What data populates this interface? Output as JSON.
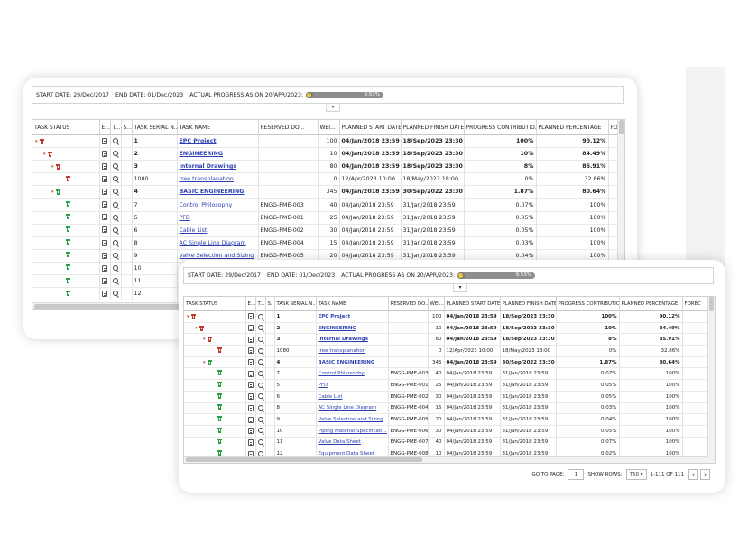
{
  "header": {
    "start_label": "START DATE:",
    "start_value": "29/Dec/2017",
    "end_label": "END DATE:",
    "end_value": "01/Dec/2023",
    "progress_label": "ACTUAL PROGRESS AS ON 20/APR/2023:",
    "progress_text": "9.53%",
    "progress_fraction": 0.0953
  },
  "columns_main": [
    "TASK STATUS",
    "E...",
    "T...",
    "S...",
    "TASK SERIAL N...",
    "TASK NAME",
    "RESERVED DO...",
    "WEI...",
    "PLANNED START DATE",
    "PLANNED FINISH DATE",
    "PROGRESS CONTRIBUTIO...",
    "PLANNED PERCENTAGE",
    "FOREC"
  ],
  "columns_front": [
    "TASK STATUS",
    "E...",
    "T...",
    "S...",
    "TASK SERIAL N...",
    "TASK NAME",
    "RESERVED DO...",
    "WEI...",
    "PLANNED START DATE",
    "PLANNED FINISH DATE",
    "PROGRESS CONTRIBUTIO...",
    "PLANNED PERCENTAGE",
    "FOREC"
  ],
  "rows_back": [
    {
      "serial": "1",
      "name": "EPC Project",
      "reserved": "",
      "weight": "100",
      "start": "04/Jan/2018 23:59",
      "finish": "18/Sep/2023 23:30",
      "contrib": "100%",
      "planned": "90.12%",
      "level": 0,
      "summary": true,
      "color": "red"
    },
    {
      "serial": "2",
      "name": "ENGINEERING",
      "reserved": "",
      "weight": "10",
      "start": "04/Jan/2018 23:59",
      "finish": "18/Sep/2023 23:30",
      "contrib": "10%",
      "planned": "84.49%",
      "level": 1,
      "summary": true,
      "color": "red"
    },
    {
      "serial": "3",
      "name": "Internal Drawings",
      "reserved": "",
      "weight": "80",
      "start": "04/Jan/2018 23:59",
      "finish": "18/Sep/2023 23:30",
      "contrib": "8%",
      "planned": "85.91%",
      "level": 2,
      "summary": true,
      "color": "red"
    },
    {
      "serial": "1080",
      "name": "tree transplanation",
      "reserved": "",
      "weight": "0",
      "start": "12/Apr/2023 10:00",
      "finish": "18/May/2023 18:00",
      "contrib": "0%",
      "planned": "32.86%",
      "level": 3,
      "summary": false,
      "color": "red"
    },
    {
      "serial": "4",
      "name": "BASIC ENGINEERING",
      "reserved": "",
      "weight": "345",
      "start": "04/Jan/2018 23:59",
      "finish": "30/Sep/2022 23:30",
      "contrib": "1.87%",
      "planned": "80.64%",
      "level": 2,
      "summary": true,
      "color": "green"
    },
    {
      "serial": "7",
      "name": "Control Philosophy",
      "reserved": "ENGG-PME-003",
      "weight": "40",
      "start": "04/Jan/2018 23:59",
      "finish": "31/Jan/2018 23:59",
      "contrib": "0.07%",
      "planned": "100%",
      "level": 3,
      "summary": false,
      "color": "green"
    },
    {
      "serial": "5",
      "name": "PFD",
      "reserved": "ENGG-PME-001",
      "weight": "25",
      "start": "04/Jan/2018 23:59",
      "finish": "31/Jan/2018 23:59",
      "contrib": "0.05%",
      "planned": "100%",
      "level": 3,
      "summary": false,
      "color": "green"
    },
    {
      "serial": "6",
      "name": "Cable List",
      "reserved": "ENGG-PME-002",
      "weight": "30",
      "start": "04/Jan/2018 23:59",
      "finish": "31/Jan/2018 23:59",
      "contrib": "0.05%",
      "planned": "100%",
      "level": 3,
      "summary": false,
      "color": "green"
    },
    {
      "serial": "8",
      "name": "AC Single Line Diagram",
      "reserved": "ENGG-PME-004",
      "weight": "15",
      "start": "04/Jan/2018 23:59",
      "finish": "31/Jan/2018 23:59",
      "contrib": "0.03%",
      "planned": "100%",
      "level": 3,
      "summary": false,
      "color": "green"
    },
    {
      "serial": "9",
      "name": "Valve Selection and Sizing",
      "reserved": "ENGG-PME-005",
      "weight": "20",
      "start": "04/Jan/2018 23:59",
      "finish": "31/Jan/2018 23:59",
      "contrib": "0.04%",
      "planned": "100%",
      "level": 3,
      "summary": false,
      "color": "green"
    },
    {
      "serial": "10",
      "name": "",
      "reserved": "",
      "weight": "",
      "start": "",
      "finish": "",
      "contrib": "",
      "planned": "",
      "level": 3,
      "summary": false,
      "color": "green"
    },
    {
      "serial": "11",
      "name": "",
      "reserved": "",
      "weight": "",
      "start": "",
      "finish": "",
      "contrib": "",
      "planned": "",
      "level": 3,
      "summary": false,
      "color": "green"
    },
    {
      "serial": "12",
      "name": "",
      "reserved": "",
      "weight": "",
      "start": "",
      "finish": "",
      "contrib": "",
      "planned": "",
      "level": 3,
      "summary": false,
      "color": "green"
    }
  ],
  "rows_front": [
    {
      "serial": "1",
      "name": "EPC Project",
      "reserved": "",
      "weight": "100",
      "start": "04/Jan/2018 23:59",
      "finish": "18/Sep/2023 23:30",
      "contrib": "100%",
      "planned": "90.12%",
      "level": 0,
      "summary": true,
      "color": "red"
    },
    {
      "serial": "2",
      "name": "ENGINEERING",
      "reserved": "",
      "weight": "10",
      "start": "04/Jan/2018 23:59",
      "finish": "18/Sep/2023 23:30",
      "contrib": "10%",
      "planned": "84.49%",
      "level": 1,
      "summary": true,
      "color": "red"
    },
    {
      "serial": "3",
      "name": "Internal Drawings",
      "reserved": "",
      "weight": "80",
      "start": "04/Jan/2018 23:59",
      "finish": "18/Sep/2023 23:30",
      "contrib": "8%",
      "planned": "85.91%",
      "level": 2,
      "summary": true,
      "color": "red"
    },
    {
      "serial": "1080",
      "name": "tree transplanation",
      "reserved": "",
      "weight": "0",
      "start": "12/Apr/2023 10:00",
      "finish": "18/May/2023 18:00",
      "contrib": "0%",
      "planned": "32.86%",
      "level": 3,
      "summary": false,
      "color": "red"
    },
    {
      "serial": "4",
      "name": "BASIC ENGINEERING",
      "reserved": "",
      "weight": "345",
      "start": "04/Jan/2018 23:59",
      "finish": "30/Sep/2022 23:30",
      "contrib": "1.87%",
      "planned": "80.64%",
      "level": 2,
      "summary": true,
      "color": "green"
    },
    {
      "serial": "7",
      "name": "Control Philosophy",
      "reserved": "ENGG-PME-003",
      "weight": "40",
      "start": "04/Jan/2018 23:59",
      "finish": "31/Jan/2018 23:59",
      "contrib": "0.07%",
      "planned": "100%",
      "level": 3,
      "summary": false,
      "color": "green"
    },
    {
      "serial": "5",
      "name": "PFD",
      "reserved": "ENGG-PME-001",
      "weight": "25",
      "start": "04/Jan/2018 23:59",
      "finish": "31/Jan/2018 23:59",
      "contrib": "0.05%",
      "planned": "100%",
      "level": 3,
      "summary": false,
      "color": "green"
    },
    {
      "serial": "6",
      "name": "Cable List",
      "reserved": "ENGG-PME-002",
      "weight": "30",
      "start": "04/Jan/2018 23:59",
      "finish": "31/Jan/2018 23:59",
      "contrib": "0.05%",
      "planned": "100%",
      "level": 3,
      "summary": false,
      "color": "green"
    },
    {
      "serial": "8",
      "name": "AC Single Line Diagram",
      "reserved": "ENGG-PME-004",
      "weight": "15",
      "start": "04/Jan/2018 23:59",
      "finish": "31/Jan/2018 23:59",
      "contrib": "0.03%",
      "planned": "100%",
      "level": 3,
      "summary": false,
      "color": "green"
    },
    {
      "serial": "9",
      "name": "Valve Selection and Sizing",
      "reserved": "ENGG-PME-005",
      "weight": "20",
      "start": "04/Jan/2018 23:59",
      "finish": "31/Jan/2018 23:59",
      "contrib": "0.04%",
      "planned": "100%",
      "level": 3,
      "summary": false,
      "color": "green"
    },
    {
      "serial": "10",
      "name": "Piping Material Specificati...",
      "reserved": "ENGG-PME-006",
      "weight": "30",
      "start": "04/Jan/2018 23:59",
      "finish": "31/Jan/2018 23:59",
      "contrib": "0.05%",
      "planned": "100%",
      "level": 3,
      "summary": false,
      "color": "green"
    },
    {
      "serial": "11",
      "name": "Valve Data Sheet",
      "reserved": "ENGG-PME-007",
      "weight": "40",
      "start": "04/Jan/2018 23:59",
      "finish": "31/Jan/2018 23:59",
      "contrib": "0.07%",
      "planned": "100%",
      "level": 3,
      "summary": false,
      "color": "green"
    },
    {
      "serial": "12",
      "name": "Equipment Data Sheet",
      "reserved": "ENGG-PME-008",
      "weight": "10",
      "start": "04/Jan/2018 23:59",
      "finish": "31/Jan/2018 23:59",
      "contrib": "0.02%",
      "planned": "100%",
      "level": 3,
      "summary": false,
      "color": "green"
    }
  ],
  "footer": {
    "goto_label": "GO TO PAGE:",
    "goto_value": "1",
    "show_rows_label": "SHOW ROWS:",
    "show_rows_value": "750",
    "range_text": "1-111 OF 111",
    "prev_glyph": "‹",
    "next_glyph": "›"
  },
  "colors": {
    "link": "#2a3fb0",
    "status_red": "#c0392b",
    "status_green": "#27a243",
    "progress_dot": "#f2c230"
  }
}
